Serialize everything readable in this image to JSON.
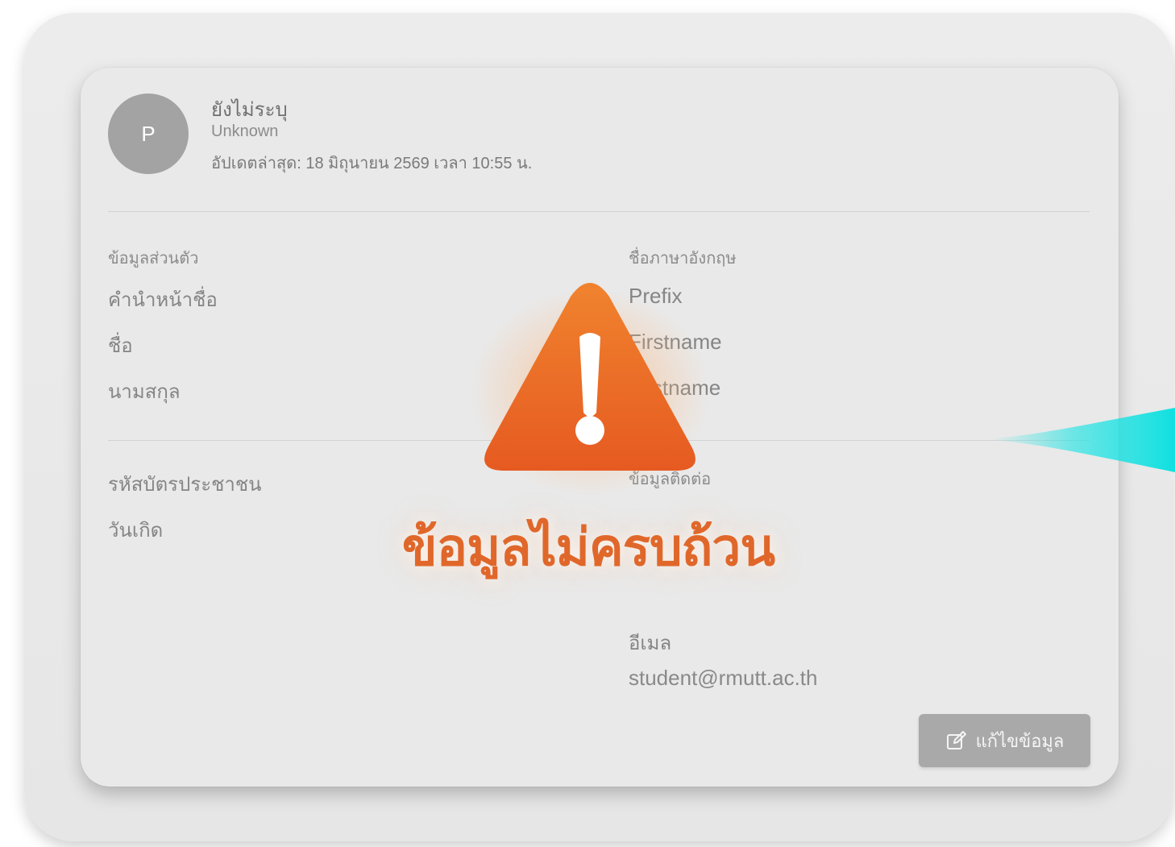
{
  "profile": {
    "avatar_letter": "P",
    "name": "ยังไม่ระบุ",
    "subtitle": "Unknown",
    "updated": "อัปเดตล่าสุด: 18 มิถุนายน 2569 เวลา 10:55 น."
  },
  "thai_section": {
    "label": "ข้อมูลส่วนตัว",
    "fields": [
      "คำนำหน้าชื่อ",
      "ชื่อ",
      "นามสกุล"
    ]
  },
  "english_section": {
    "label": "ชื่อภาษาอังกฤษ",
    "fields": [
      "Prefix",
      "Firstname",
      "Lastname"
    ]
  },
  "id_section": {
    "fields": [
      "รหัสบัตรประชาชน",
      "วันเกิด"
    ]
  },
  "contact_section": {
    "label": "ข้อมูลติดต่อ",
    "email_label": "อีเมล",
    "email_value": "student@rmutt.ac.th"
  },
  "edit_button": {
    "label": "แก้ไขข้อมูล",
    "icon": "edit-icon"
  },
  "alert": {
    "icon": "warning-icon",
    "message": "ข้อมูลไม่ครบถ้วน"
  },
  "colors": {
    "warning_orange": "#e8692a",
    "accent_teal": "#17e3e3",
    "button_gray": "#a9a9a9"
  }
}
